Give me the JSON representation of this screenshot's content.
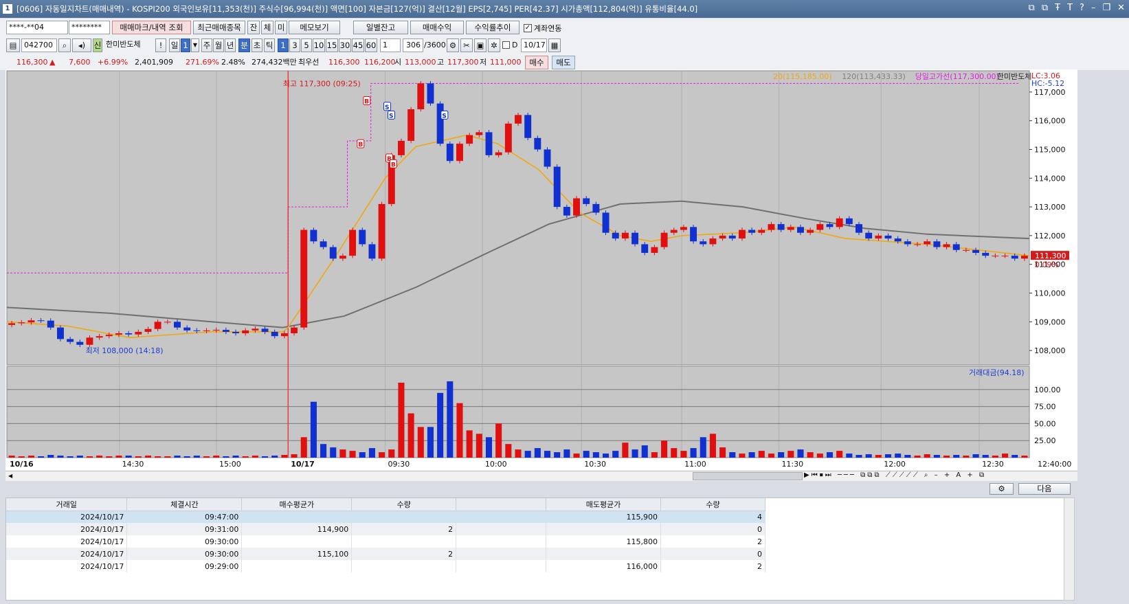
{
  "titlebar": {
    "icon": "1",
    "text": "[0606] 자동일지차트(매매내역) - KOSPI200 외국인보유[11,353(천)] 주식수[96,994(천)] 액면[100] 자본금[127(억)] 결산[12월] EPS[2,745] PER[42.37] 시가총액[112,804(억)] 유통비율[44.0]",
    "controls": [
      "⧉",
      "⧉",
      "Ŧ",
      "T",
      "?",
      "–",
      "❐",
      "✕"
    ]
  },
  "toolbar1": {
    "account": "****-**04",
    "password": "********",
    "btn_marks": "매매마크/내역 조회",
    "btn_recent": "최근매매종목",
    "btn_jan": "잔",
    "btn_che": "체",
    "btn_mi": "미",
    "btn_memo": "메모보기",
    "btn_daily": "일별잔고",
    "btn_profit": "매매수익",
    "btn_rate": "수익률추이",
    "chk_account_link": "계좌연동"
  },
  "toolbar2": {
    "code": "042700",
    "badge_sin": "신",
    "name": "한미반도체",
    "excl": "!",
    "btn_day": "일",
    "day_num": "1",
    "periods": [
      "주",
      "월",
      "년",
      "분",
      "초",
      "틱"
    ],
    "minute_opts": [
      "1",
      "3",
      "5",
      "10",
      "15",
      "30",
      "45",
      "60"
    ],
    "multiplier": "1",
    "count": "306",
    "count_max": "/3600",
    "d_label": "D",
    "date": "10/17"
  },
  "quote": {
    "price": "116,300",
    "arrow": "▲",
    "change": "7,600",
    "change_pct": "+6.99%",
    "volume": "2,401,909",
    "vol_ratio": "271.69%",
    "turnover": "2.48%",
    "amount": "274,432백만",
    "priority_label": "최우선",
    "ask": "116,300",
    "bid": "116,200",
    "open_label": "시",
    "open": "113,000",
    "high_label": "고",
    "high": "117,300",
    "low_label": "저",
    "low": "111,000",
    "buy_btn": "매수",
    "sell_btn": "매도"
  },
  "chart_data": {
    "type": "candlestick",
    "legend": [
      {
        "text": "20(115,185.00)",
        "color": "#f0a810"
      },
      {
        "text": "120(113,433.33)",
        "color": "#808080"
      },
      {
        "text": "당일고가선(117,300.00)",
        "color": "#e020e0"
      },
      {
        "text": "한미반도체",
        "color": "#222222"
      }
    ],
    "lc_hc": [
      "LC:3.06",
      "HC:-5.12"
    ],
    "y_ticks": [
      "117,000",
      "116,000",
      "115,000",
      "114,000",
      "113,000",
      "112,000",
      "111,000",
      "110,000",
      "109,000",
      "108,000"
    ],
    "ylim": [
      107500,
      117500
    ],
    "current_price": "111,300",
    "current_pct": "0.09%",
    "high_annotation": "최고 117,300 (09:25)",
    "low_annotation": "최저 108,000 (14:18)",
    "x_labels": [
      "10/16",
      "14:30",
      "15:00",
      "10/17",
      "09:30",
      "10:00",
      "10:30",
      "11:00",
      "11:30",
      "12:00",
      "12:30",
      "12:40:00"
    ],
    "ohlc_anchors_close": [
      108950,
      108980,
      109050,
      109040,
      108800,
      108400,
      108300,
      108200,
      108450,
      108500,
      108550,
      108600,
      108560,
      108650,
      108750,
      109000,
      109000,
      108800,
      108700,
      108680,
      108700,
      108720,
      108650,
      108600,
      108700,
      108760,
      108650,
      108500,
      108600,
      108800,
      112200,
      111800,
      111600,
      111200,
      111300,
      112200,
      111700,
      111200,
      113100,
      114800,
      115300,
      116400,
      117300,
      116600,
      115200,
      114600,
      115200,
      115500,
      115600,
      114800,
      114900,
      115900,
      116200,
      115400,
      115000,
      114400,
      113000,
      112700,
      113300,
      113100,
      112800,
      112100,
      111900,
      112100,
      111700,
      111400,
      111600,
      112100,
      112200,
      112300,
      111800,
      111700,
      111900,
      112000,
      111900,
      112200,
      112100,
      112200,
      112400,
      112200,
      112300,
      112100,
      112200,
      112400,
      112300,
      112600,
      112400,
      112100,
      111900,
      112000,
      111900,
      111800,
      111700,
      111700,
      111800,
      111600,
      111700,
      111500,
      111500,
      111400,
      111300,
      111300,
      111300,
      111200,
      111300
    ],
    "ma20_anchors": [
      [
        0,
        109000
      ],
      [
        0.06,
        108850
      ],
      [
        0.12,
        108450
      ],
      [
        0.2,
        108650
      ],
      [
        0.27,
        108650
      ],
      [
        0.275,
        108800
      ],
      [
        0.32,
        111200
      ],
      [
        0.37,
        114000
      ],
      [
        0.4,
        115100
      ],
      [
        0.45,
        115500
      ],
      [
        0.48,
        115200
      ],
      [
        0.52,
        114300
      ],
      [
        0.56,
        112800
      ],
      [
        0.6,
        112000
      ],
      [
        0.63,
        111800
      ],
      [
        0.66,
        112000
      ],
      [
        0.72,
        112100
      ],
      [
        0.77,
        112300
      ],
      [
        0.82,
        111900
      ],
      [
        0.9,
        111700
      ],
      [
        0.95,
        111500
      ],
      [
        1.0,
        111300
      ]
    ],
    "ma120_anchors": [
      [
        0,
        109500
      ],
      [
        0.1,
        109300
      ],
      [
        0.2,
        109000
      ],
      [
        0.27,
        108800
      ],
      [
        0.33,
        109200
      ],
      [
        0.4,
        110200
      ],
      [
        0.47,
        111400
      ],
      [
        0.53,
        112400
      ],
      [
        0.6,
        113100
      ],
      [
        0.66,
        113200
      ],
      [
        0.72,
        113000
      ],
      [
        0.78,
        112600
      ],
      [
        0.84,
        112250
      ],
      [
        0.9,
        112050
      ],
      [
        1.0,
        111900
      ]
    ],
    "high_line": 117300,
    "prev_high_line": 110700,
    "volume_legend": "거래대금(94.18)",
    "volume_ticks": [
      "100.00",
      "75.00",
      "50.00",
      "25.00"
    ],
    "volume_ylim": [
      0,
      120
    ],
    "volume_bars": [
      3,
      2,
      3,
      2,
      4,
      3,
      2,
      3,
      2,
      3,
      2,
      3,
      3,
      2,
      3,
      2,
      2,
      3,
      2,
      3,
      2,
      3,
      2,
      3,
      2,
      3,
      2,
      3,
      4,
      5,
      30,
      82,
      20,
      15,
      12,
      10,
      8,
      14,
      8,
      12,
      110,
      65,
      45,
      45,
      95,
      112,
      80,
      40,
      35,
      30,
      50,
      20,
      12,
      10,
      14,
      10,
      8,
      12,
      6,
      10,
      8,
      6,
      10,
      22,
      12,
      18,
      8,
      25,
      14,
      10,
      14,
      30,
      35,
      15,
      8,
      6,
      8,
      10,
      6,
      8,
      10,
      12,
      8,
      6,
      8,
      10,
      6,
      4,
      5,
      4,
      5,
      6,
      4,
      3,
      5,
      4,
      3,
      4,
      3,
      5,
      4,
      3,
      6,
      4,
      3
    ]
  },
  "bottom_toolbar": {
    "btn_settings": "⚙",
    "btn_next": "다음"
  },
  "orders": {
    "headers": [
      "거래일",
      "체결시간",
      "매수평균가",
      "수량",
      "",
      "매도평균가",
      "수량"
    ],
    "rows": [
      [
        "2024/10/17",
        "09:47:00",
        "",
        "",
        "",
        "115,900",
        "4"
      ],
      [
        "2024/10/17",
        "09:31:00",
        "114,900",
        "2",
        "",
        "",
        "0"
      ],
      [
        "2024/10/17",
        "09:30:00",
        "",
        "",
        "",
        "115,800",
        "2"
      ],
      [
        "2024/10/17",
        "09:30:00",
        "115,100",
        "2",
        "",
        "",
        "0"
      ],
      [
        "2024/10/17",
        "09:29:00",
        "",
        "",
        "",
        "116,000",
        "2"
      ]
    ]
  }
}
